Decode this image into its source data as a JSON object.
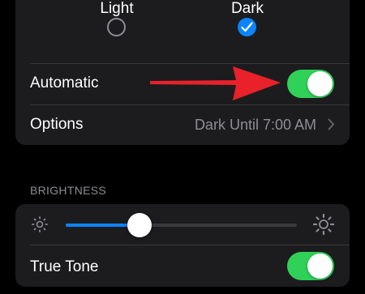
{
  "appearance": {
    "light_label": "Light",
    "dark_label": "Dark",
    "selected": "Dark"
  },
  "automatic": {
    "label": "Automatic",
    "on": true
  },
  "options": {
    "label": "Options",
    "value": "Dark Until 7:00 AM"
  },
  "brightness": {
    "header": "BRIGHTNESS",
    "level": 0.32
  },
  "true_tone": {
    "label": "True Tone",
    "on": true
  },
  "colors": {
    "background": "#000000",
    "group": "#1c1c1e",
    "accent": "#0a84ff",
    "toggle_on": "#30d158",
    "secondary_text": "#8e8e93",
    "annotation_arrow": "#e8212b"
  },
  "icons": [
    "checkmark-icon",
    "chevron-right-icon",
    "sun-small-icon",
    "sun-large-icon",
    "red-arrow-annotation"
  ]
}
